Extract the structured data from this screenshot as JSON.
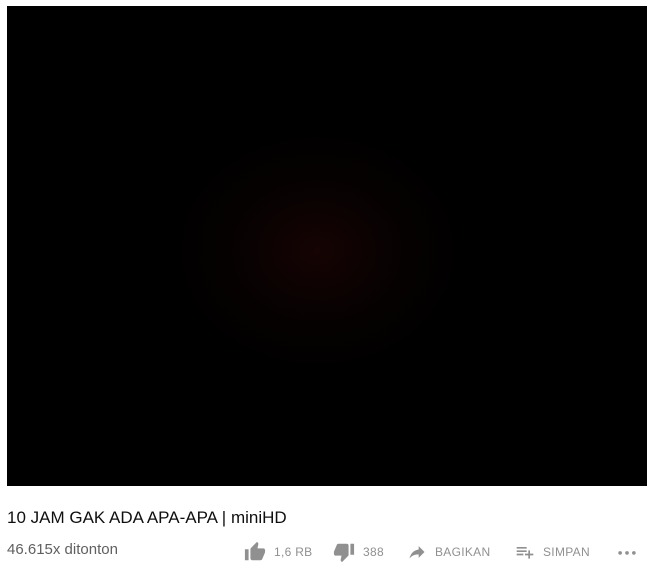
{
  "video": {
    "title": "10 JAM GAK ADA APA-APA | miniHD",
    "views": "46.615x ditonton"
  },
  "actions": {
    "like_count": "1,6 RB",
    "dislike_count": "388",
    "share_label": "BAGIKAN",
    "save_label": "SIMPAN"
  },
  "icons": {
    "like": "thumb-up-icon",
    "dislike": "thumb-down-icon",
    "share": "share-arrow-icon",
    "save": "playlist-add-icon",
    "more": "more-horizontal-icon"
  },
  "colors": {
    "icon": "#909090",
    "text_primary": "#0f0f0f",
    "text_secondary": "#606060",
    "player_bg": "#000000"
  }
}
